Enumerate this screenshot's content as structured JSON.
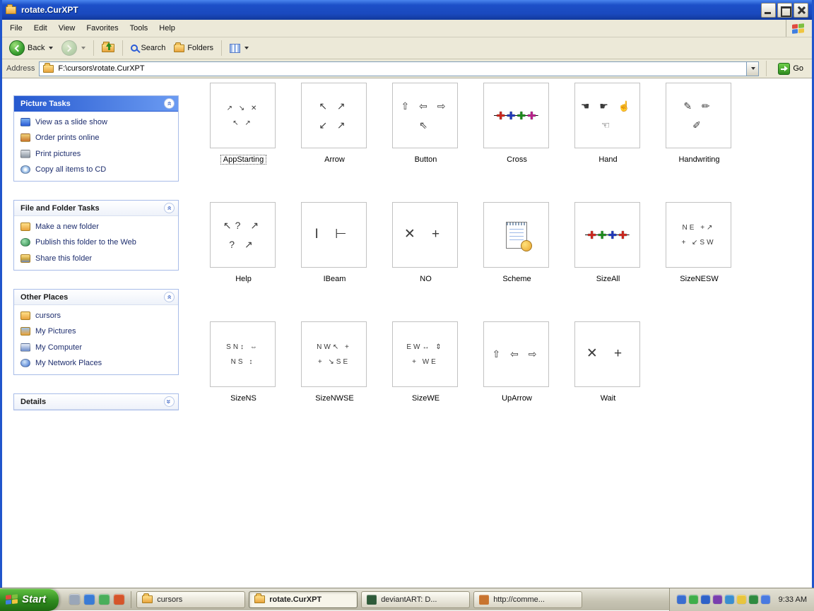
{
  "window": {
    "title": "rotate.CurXPT"
  },
  "menu": {
    "items": [
      "File",
      "Edit",
      "View",
      "Favorites",
      "Tools",
      "Help"
    ]
  },
  "toolbar": {
    "back": "Back",
    "search": "Search",
    "folders": "Folders"
  },
  "address": {
    "label": "Address",
    "value": "F:\\cursors\\rotate.CurXPT",
    "go": "Go"
  },
  "sidebar": {
    "panels": [
      {
        "title": "Picture Tasks",
        "hot": true,
        "collapsed": false,
        "items": [
          {
            "label": "View as a slide show",
            "icon": "slideshow"
          },
          {
            "label": "Order prints online",
            "icon": "order-prints"
          },
          {
            "label": "Print pictures",
            "icon": "printer"
          },
          {
            "label": "Copy all items to CD",
            "icon": "cd"
          }
        ]
      },
      {
        "title": "File and Folder Tasks",
        "hot": false,
        "collapsed": false,
        "items": [
          {
            "label": "Make a new folder",
            "icon": "new-folder"
          },
          {
            "label": "Publish this folder to the Web",
            "icon": "publish-web"
          },
          {
            "label": "Share this folder",
            "icon": "share-folder"
          }
        ]
      },
      {
        "title": "Other Places",
        "hot": false,
        "collapsed": false,
        "items": [
          {
            "label": "cursors",
            "icon": "folder"
          },
          {
            "label": "My Pictures",
            "icon": "my-pictures"
          },
          {
            "label": "My Computer",
            "icon": "my-computer"
          },
          {
            "label": "My Network Places",
            "icon": "network"
          }
        ]
      },
      {
        "title": "Details",
        "hot": false,
        "collapsed": true,
        "items": []
      }
    ]
  },
  "files": [
    {
      "name": "AppStarting",
      "selected": true,
      "small": true,
      "thumb": "↗ ↘ ✕\n↖  ↗"
    },
    {
      "name": "Arrow",
      "thumb": "↖ ↗\n↙ ↗"
    },
    {
      "name": "Button",
      "thumb": "⇧ ⇦ ⇨\n⇖"
    },
    {
      "name": "Cross",
      "stars": [
        {
          "ch": "✚",
          "color": "#c9271e"
        },
        {
          "ch": "✚",
          "color": "#2038b8"
        },
        {
          "ch": "✚",
          "color": "#1d8a1d"
        },
        {
          "ch": "✚",
          "color": "#b8208a"
        }
      ]
    },
    {
      "name": "Hand",
      "thumb": "☚ ☛ ☝\n☜"
    },
    {
      "name": "Handwriting",
      "thumb": "✎ ✏\n✐"
    },
    {
      "name": "Help",
      "thumb": "↖? ↗\n? ↗"
    },
    {
      "name": "IBeam",
      "large": true,
      "thumb": "I ⊢"
    },
    {
      "name": "NO",
      "large": true,
      "thumb": "✕ +"
    },
    {
      "name": "Scheme",
      "icon": "scheme-doc"
    },
    {
      "name": "SizeAll",
      "stars": [
        {
          "ch": "✚",
          "color": "#c9271e"
        },
        {
          "ch": "✚",
          "color": "#1d8a1d"
        },
        {
          "ch": "✚",
          "color": "#2038b8"
        },
        {
          "ch": "✚",
          "color": "#c9271e"
        }
      ]
    },
    {
      "name": "SizeNESW",
      "small": true,
      "thumb": "NE +↗\n+ ↙SW"
    },
    {
      "name": "SizeNS",
      "small": true,
      "thumb": "SN↕ ⇔\nNS ↕"
    },
    {
      "name": "SizeNWSE",
      "small": true,
      "thumb": "NW↖ +\n+ ↘SE"
    },
    {
      "name": "SizeWE",
      "small": true,
      "thumb": "EW↔ ⇕\n+ WE"
    },
    {
      "name": "UpArrow",
      "thumb": "⇧ ⇦ ⇨"
    },
    {
      "name": "Wait",
      "large": true,
      "thumb": "✕ +"
    }
  ],
  "taskbar": {
    "start": "Start",
    "quick_launch": [
      {
        "name": "launch-app",
        "color": "#9aa6b8"
      },
      {
        "name": "internet-explorer",
        "color": "#3a7bd5"
      },
      {
        "name": "media-player",
        "color": "#4aae5a"
      },
      {
        "name": "firefox",
        "color": "#d5542a"
      }
    ],
    "buttons": [
      {
        "label": "cursors",
        "icon": "folder",
        "active": false
      },
      {
        "label": "rotate.CurXPT",
        "icon": "folder",
        "active": true
      },
      {
        "label": "deviantART: D...",
        "icon": "app",
        "icon_color": "#2f5b3a",
        "active": false
      },
      {
        "label": "http://comme...",
        "icon": "app",
        "icon_color": "#c8742f",
        "active": false
      }
    ],
    "tray": [
      {
        "name": "tray-app-1",
        "color": "#3a6ed0"
      },
      {
        "name": "tray-app-2",
        "color": "#3fae4a"
      },
      {
        "name": "tray-app-3",
        "color": "#2f62c8"
      },
      {
        "name": "tray-app-4",
        "color": "#7a3fae"
      },
      {
        "name": "tray-app-5",
        "color": "#3a8ed0"
      },
      {
        "name": "tray-app-6",
        "color": "#e8c53d"
      },
      {
        "name": "tray-app-7",
        "color": "#2f8b3f"
      },
      {
        "name": "tray-app-8",
        "color": "#4a7ae0"
      }
    ],
    "clock": "9:33 AM"
  },
  "colors": {
    "titlebar_blue": "#1c50c8",
    "panel_border": "#a8bce8",
    "hot_header_from": "#2659cf",
    "hot_header_to": "#6b9bf2",
    "start_green": "#2f8b1f",
    "taskbar_beige": "#c6c3b2",
    "star_red": "#c9271e",
    "star_blue": "#2038b8",
    "star_green": "#1d8a1d",
    "star_purple": "#b8208a"
  }
}
